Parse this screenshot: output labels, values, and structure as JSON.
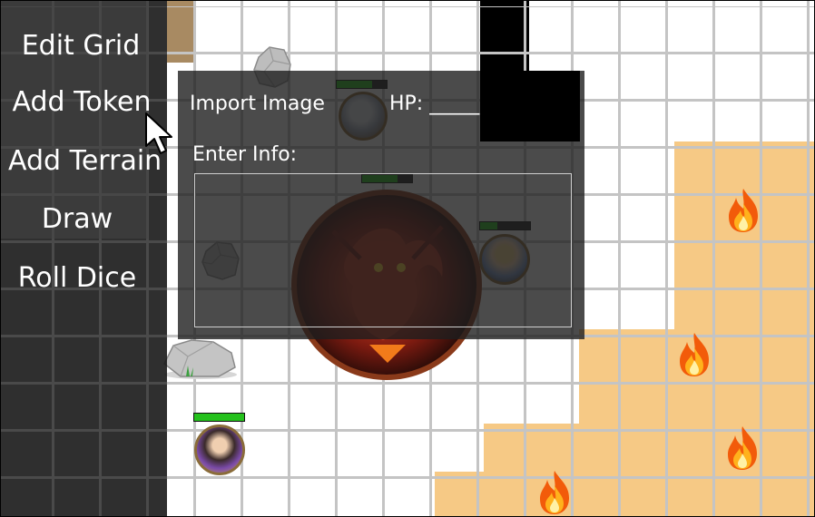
{
  "menu": {
    "items": [
      {
        "label": "Edit Grid"
      },
      {
        "label": "Add Token"
      },
      {
        "label": "Add Terrain"
      },
      {
        "label": "Draw"
      },
      {
        "label": "Roll Dice"
      }
    ]
  },
  "panel": {
    "import_label": "Import Image",
    "hp_label": "HP: _____",
    "info_label": "Enter Info:",
    "info_value": ""
  },
  "tokens": [
    {
      "name": "knight-token",
      "hp_fraction": 0.7
    },
    {
      "name": "red-dragon-token",
      "hp_fraction": 0.7
    },
    {
      "name": "blonde-hero-token",
      "hp_fraction": 0.35
    },
    {
      "name": "dark-hair-hero-token",
      "hp_fraction": 1.0
    }
  ],
  "icons": [
    "rock-icon",
    "fire-icon",
    "mouse-cursor-icon"
  ],
  "colors": {
    "sand": "#f6c985",
    "hp_fill": "#24c11c",
    "menu_bg": "#181818",
    "grid_line": "#c4c4c4"
  }
}
